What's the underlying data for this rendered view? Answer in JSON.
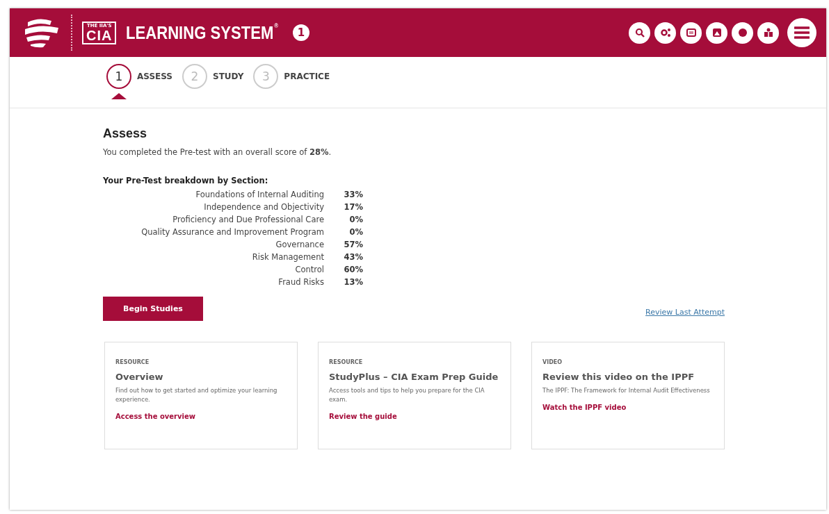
{
  "header": {
    "logo_small": "THE IIA'S",
    "logo_main": "CIA",
    "title": "LEARNING SYSTEM",
    "title_mark": "®",
    "badge": "1"
  },
  "steps": [
    {
      "number": "1",
      "label": "ASSESS",
      "selected": true
    },
    {
      "number": "2",
      "label": "STUDY",
      "selected": false
    },
    {
      "number": "3",
      "label": "PRACTICE",
      "selected": false
    }
  ],
  "assess": {
    "title": "Assess",
    "summary": "You completed the Pre-test with an overall score of **28%**.",
    "breakdown_title": "Your Pre-Test breakdown by Section:",
    "sections": [
      {
        "name": "Foundations of Internal Auditing",
        "score": "33%"
      },
      {
        "name": "Independence and Objectivity",
        "score": "17%"
      },
      {
        "name": "Proficiency and Due Professional Care",
        "score": "0%"
      },
      {
        "name": "Quality Assurance and Improvement Program",
        "score": "0%"
      },
      {
        "name": "Governance",
        "score": "57%"
      },
      {
        "name": "Risk Management",
        "score": "43%"
      },
      {
        "name": "Control",
        "score": "60%"
      },
      {
        "name": "Fraud Risks",
        "score": "13%"
      }
    ],
    "button": "Begin Studies",
    "review_link": "Review Last Attempt"
  },
  "cards": [
    {
      "category": "RESOURCE",
      "title": "Overview",
      "description": "Find out how to get started and optimize your learning experience.",
      "link": "Access the overview"
    },
    {
      "category": "RESOURCE",
      "title": "StudyPlus – CIA Exam Prep Guide",
      "description": "Access tools and tips to help you prepare for the CIA exam.",
      "link": "Review the guide"
    },
    {
      "category": "VIDEO",
      "title": "Review this video on the IPPF",
      "description": "The IPPF: The Framework for Internal Audit Effectiveness",
      "link": "Watch the IPPF video"
    }
  ]
}
